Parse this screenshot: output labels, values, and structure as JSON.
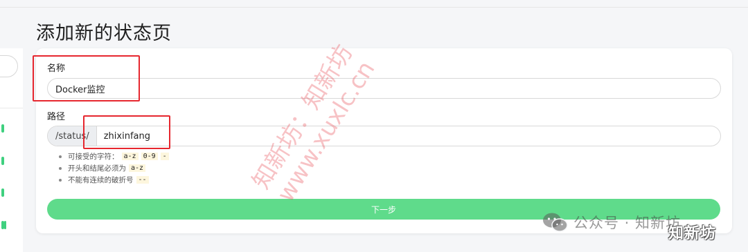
{
  "page": {
    "title": "添加新的状态页"
  },
  "form": {
    "name_label": "名称",
    "name_value": "Docker监控",
    "path_label": "路径",
    "path_prefix": "/status/",
    "path_value": "zhixinfang",
    "hints": [
      {
        "text": "可接受的字符：",
        "codes": [
          "a-z",
          "0-9",
          "-"
        ]
      },
      {
        "text": "开头和结尾必须为",
        "codes": [
          "a-z"
        ]
      },
      {
        "text": "不能有连续的破折号",
        "codes": [
          "--"
        ]
      }
    ],
    "next_button": "下一步"
  },
  "watermark": {
    "line1": "知新坊：知新坊",
    "line2": "www.xuxlc.cn",
    "bottom": "公众号 · 知新坊",
    "brand": "知新坊"
  },
  "colors": {
    "accent": "#5fdb8b",
    "highlight_box": "#e6262e",
    "status_bar": "#3fd07f"
  }
}
